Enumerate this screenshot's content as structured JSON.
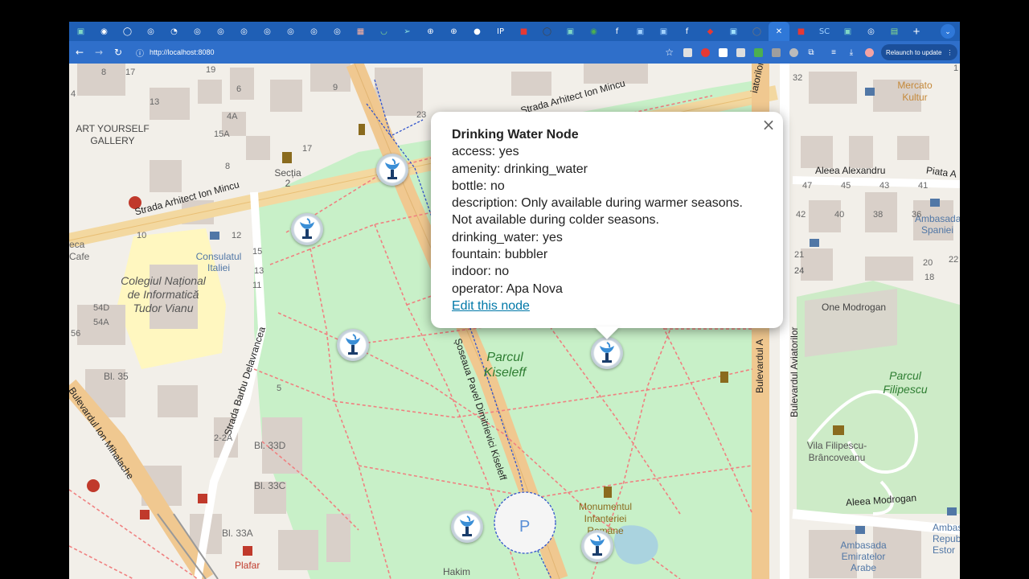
{
  "browser": {
    "tabs": [
      {
        "name": "tab-1",
        "glyph": "▣",
        "color": "#7fd6c6"
      },
      {
        "name": "tab-2",
        "glyph": "◉",
        "color": "#ffffff"
      },
      {
        "name": "tab-3",
        "glyph": "◯",
        "color": "#ffffff"
      },
      {
        "name": "tab-4",
        "glyph": "◎",
        "color": "#ffffff"
      },
      {
        "name": "tab-5",
        "glyph": "◔",
        "color": "#ffffff"
      },
      {
        "name": "tab-6",
        "glyph": "◎",
        "color": "#ffffff"
      },
      {
        "name": "tab-7",
        "glyph": "◎",
        "color": "#ffffff"
      },
      {
        "name": "tab-8",
        "glyph": "◎",
        "color": "#ffffff"
      },
      {
        "name": "tab-9",
        "glyph": "◎",
        "color": "#ffffff"
      },
      {
        "name": "tab-10",
        "glyph": "◎",
        "color": "#ffffff"
      },
      {
        "name": "tab-11",
        "glyph": "◎",
        "color": "#ffffff"
      },
      {
        "name": "tab-12",
        "glyph": "◎",
        "color": "#ffffff"
      },
      {
        "name": "tab-13",
        "glyph": "▦",
        "color": "#ffb3a0"
      },
      {
        "name": "tab-14",
        "glyph": "◡",
        "color": "#8be08b"
      },
      {
        "name": "tab-15",
        "glyph": "➢",
        "color": "#8be0e0"
      },
      {
        "name": "tab-16",
        "glyph": "⊕",
        "color": "#ffffff"
      },
      {
        "name": "tab-17",
        "glyph": "⊕",
        "color": "#ffffff"
      },
      {
        "name": "tab-18",
        "glyph": "●",
        "color": "#ffffff"
      },
      {
        "name": "tab-19",
        "glyph": "IP",
        "color": "#ffffff"
      },
      {
        "name": "tab-20",
        "glyph": "■",
        "color": "#e53935"
      },
      {
        "name": "tab-21",
        "glyph": "◯",
        "color": "#444444"
      },
      {
        "name": "tab-22",
        "glyph": "▣",
        "color": "#7fd6c6"
      },
      {
        "name": "tab-23",
        "glyph": "◉",
        "color": "#4caf50"
      },
      {
        "name": "tab-24",
        "glyph": "f",
        "color": "#ffffff"
      },
      {
        "name": "tab-25",
        "glyph": "▣",
        "color": "#9fd0ff"
      },
      {
        "name": "tab-26",
        "glyph": "▣",
        "color": "#9fd0ff"
      },
      {
        "name": "tab-27",
        "glyph": "f",
        "color": "#ffffff"
      },
      {
        "name": "tab-28",
        "glyph": "◆",
        "color": "#e53935"
      },
      {
        "name": "tab-29",
        "glyph": "▣",
        "color": "#9fe0ff"
      },
      {
        "name": "tab-30",
        "glyph": "◯",
        "color": "#777777"
      },
      {
        "name": "tab-active",
        "glyph": "✕",
        "color": "#ffffff",
        "active": true
      },
      {
        "name": "tab-31",
        "glyph": "■",
        "color": "#e53935"
      },
      {
        "name": "tab-32",
        "glyph": "SC",
        "color": "#9fd0ff"
      },
      {
        "name": "tab-33",
        "glyph": "▣",
        "color": "#7fd6c6"
      },
      {
        "name": "tab-34",
        "glyph": "◎",
        "color": "#ffffff"
      },
      {
        "name": "tab-35",
        "glyph": "▤",
        "color": "#8be08b"
      }
    ],
    "new_tab_label": "+",
    "tab_list_label": "⌄",
    "url": "http://localhost:8080",
    "relaunch_label": "Relaunch to update",
    "relaunch_menu": "⋮"
  },
  "map": {
    "popup": {
      "title": "Drinking Water Node",
      "lines": [
        "access: yes",
        "amenity: drinking_water",
        "bottle: no",
        "description: Only available during warmer seasons.",
        "Not available during colder seasons.",
        "drinking_water: yes",
        "fountain: bubbler",
        "indoor: no",
        "operator: Apa Nova"
      ],
      "edit_link": "Edit this node",
      "close_label": "×"
    },
    "labels": {
      "street_arhitect_ion_mincu_1": "Strada Arhitect Ion Mincu",
      "street_arhitect_ion_mincu_2": "Strada Arhitect Ion Mincu",
      "street_barbu_delavrancea": "Strada Barbu Delavrancea",
      "street_ion_mihalache": "Bulevardul Ion Mihalache",
      "soseaua_kiseleff": "Șoseaua Pavel Dimitrievici Kiseleff",
      "bulevardul_aviatorilor": "Bulevardul Aviatorilor",
      "aleea_alexandru": "Aleea Alexandru",
      "aleea_modrogan": "Aleea Modrogan",
      "piata": "Piata A",
      "parcul_kiseleff": "Parcul Kiseleff",
      "parcul_filipescu": "Parcul Filipescu",
      "art_yourself": "ART YOURSELF GALLERY",
      "sectia": "Secția 2",
      "consulatul": "Consulatul Italiei",
      "colegiul": "Colegiul Național de Informatică Tudor Vianu",
      "one_modrogan": "One Modrogan",
      "vila_filipescu": "Vila Filipescu-Brâncoveanu",
      "monumentul": "Monumentul Infanteriei Române",
      "ambasada_spaniei": "Ambasada Spaniei",
      "ambasada_emiratelor": "Ambasada Emiratelor Arabe",
      "ambasada_republicii": "Ambas Repub Estor",
      "mercato": "Mercato Kultur",
      "eca_cafe": "eca Cafe",
      "plafar": "Plafar",
      "hakim": "Hakim",
      "bl35": "Bl. 35",
      "bl33d": "Bl. 33D",
      "bl33c": "Bl. 33C",
      "bl33a": "Bl. 33A",
      "parking": "P",
      "bulevardul_aviatorilor_2": "Bulevardul A",
      "aviatorilor_top": "iatorilor"
    },
    "numbers": [
      "8",
      "17",
      "19",
      "4",
      "13",
      "6",
      "9",
      "4A",
      "15A",
      "17",
      "8",
      "12",
      "10",
      "15",
      "13",
      "11",
      "54D",
      "54A",
      "56",
      "5",
      "2-2A",
      "23",
      "1",
      "32",
      "47",
      "45",
      "43",
      "41",
      "42",
      "40",
      "38",
      "36",
      "24",
      "22",
      "20",
      "18",
      "24",
      "21"
    ]
  }
}
